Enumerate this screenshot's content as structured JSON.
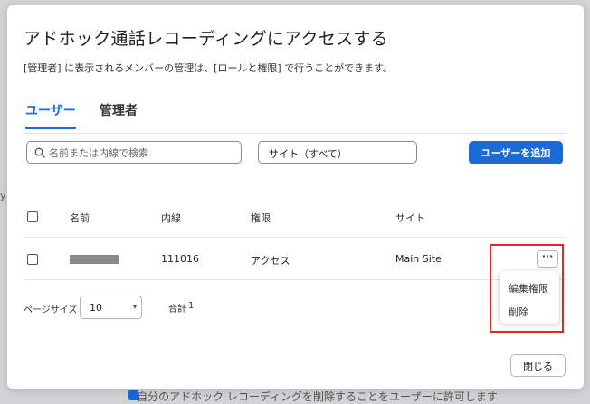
{
  "dialog": {
    "title": "アドホック通話レコーディングにアクセスする",
    "description": "[管理者] に表示されるメンバーの管理は、[ロールと権限] で行うことができます。",
    "tabs": [
      {
        "label": "ユーザー",
        "active": true
      },
      {
        "label": "管理者",
        "active": false
      }
    ],
    "search": {
      "placeholder": "名前または内線で検索",
      "value": ""
    },
    "site_filter": {
      "value": "サイト（すべて）"
    },
    "add_button_label": "ユーザーを追加",
    "table": {
      "headers": {
        "name": "名前",
        "extension": "内線",
        "permission": "権限",
        "site": "サイト"
      },
      "rows": [
        {
          "name": "",
          "extension": "111016",
          "permission": "アクセス",
          "site": "Main Site"
        }
      ]
    },
    "row_menu": {
      "more_label": "···",
      "items": [
        "編集権限",
        "削除"
      ]
    },
    "pagination": {
      "page_size_label": "ページサイズ",
      "page_size": "10",
      "total_label": "合計",
      "total": "1"
    },
    "close_button_label": "閉じる"
  },
  "background": {
    "option_text": "自分のアドホック レコーディングを削除することをユーザーに許可します"
  },
  "colors": {
    "accent": "#1a6ad8",
    "highlight": "#e02a22"
  }
}
